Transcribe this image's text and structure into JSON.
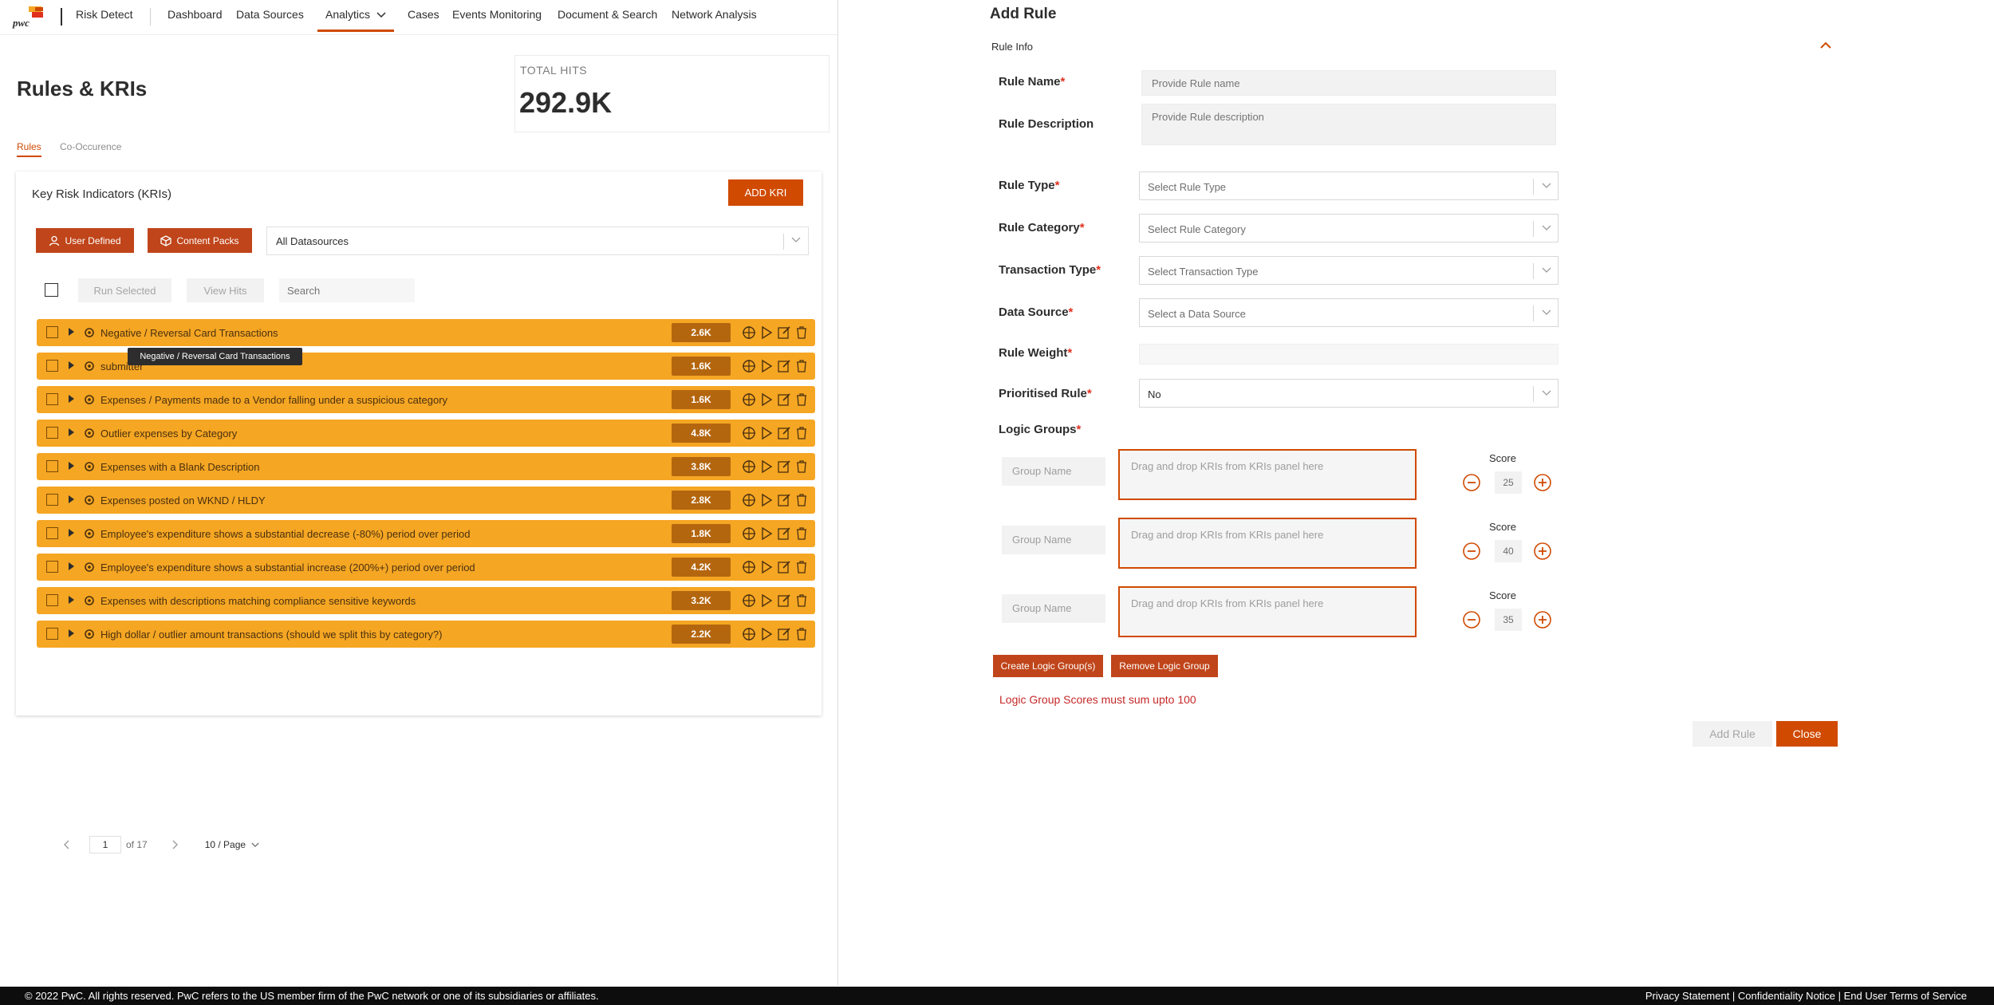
{
  "brand": {
    "logo_text": "pwc",
    "app_name": "Risk Detect",
    "accent_color": "#d04a02",
    "row_color": "#f5a623"
  },
  "nav": {
    "items": [
      {
        "label": "Dashboard"
      },
      {
        "label": "Data Sources"
      },
      {
        "label": "Analytics"
      },
      {
        "label": "Cases"
      },
      {
        "label": "Events Monitoring"
      },
      {
        "label": "Document & Search"
      },
      {
        "label": "Network Analysis"
      }
    ],
    "active": "Analytics"
  },
  "page": {
    "title": "Rules & KRIs",
    "total_hits_label": "TOTAL HITS",
    "total_hits_value": "292.9K",
    "tabs": [
      {
        "label": "Rules"
      },
      {
        "label": "Co-Occurence"
      }
    ],
    "active_tab": "Rules"
  },
  "kri_panel": {
    "title": "Key Risk Indicators (KRIs)",
    "add_kri_label": "ADD KRI",
    "filters": {
      "user_defined": "User Defined",
      "content_packs": "Content Packs"
    },
    "datasource_select": "All Datasources",
    "run_selected_label": "Run Selected",
    "view_hits_label": "View Hits",
    "search_placeholder": "Search",
    "rows": [
      {
        "name": "Negative / Reversal Card Transactions",
        "hits": "2.6K"
      },
      {
        "name": "submitter",
        "hits": "1.6K"
      },
      {
        "name": "Expenses / Payments made to a Vendor falling under a suspicious category",
        "hits": "1.6K"
      },
      {
        "name": "Outlier expenses by Category",
        "hits": "4.8K"
      },
      {
        "name": "Expenses with a Blank Description",
        "hits": "3.8K"
      },
      {
        "name": "Expenses posted on WKND / HLDY",
        "hits": "2.8K"
      },
      {
        "name": "Employee's expenditure shows a substantial decrease (-80%) period over period",
        "hits": "1.8K"
      },
      {
        "name": "Employee's expenditure shows a substantial increase (200%+) period over period",
        "hits": "4.2K"
      },
      {
        "name": "Expenses with descriptions matching compliance sensitive keywords",
        "hits": "3.2K"
      },
      {
        "name": "High dollar / outlier amount transactions (should we split this by category?)",
        "hits": "2.2K"
      }
    ],
    "tooltip": "Negative / Reversal Card Transactions",
    "pagination": {
      "current_page": "1",
      "of_text": "of 17",
      "page_size": "10 / Page"
    }
  },
  "add_rule": {
    "title": "Add Rule",
    "section": "Rule Info",
    "fields": {
      "rule_name_label": "Rule Name",
      "rule_name_placeholder": "Provide Rule name",
      "rule_description_label": "Rule Description",
      "rule_description_placeholder": "Provide Rule description",
      "rule_type_label": "Rule Type",
      "rule_type_value": "Select Rule Type",
      "rule_category_label": "Rule Category",
      "rule_category_value": "Select Rule Category",
      "transaction_type_label": "Transaction Type",
      "transaction_type_value": "Select Transaction Type",
      "data_source_label": "Data Source",
      "data_source_value": "Select a Data Source",
      "rule_weight_label": "Rule Weight",
      "prioritised_label": "Prioritised Rule",
      "prioritised_value": "No",
      "logic_groups_label": "Logic Groups",
      "required_mark": "*"
    },
    "logic_groups": [
      {
        "group_name": "Group Name",
        "drop_text": "Drag and drop KRIs from KRIs panel here",
        "score_label": "Score",
        "score": "25"
      },
      {
        "group_name": "Group Name",
        "drop_text": "Drag and drop KRIs from KRIs panel here",
        "score_label": "Score",
        "score": "40"
      },
      {
        "group_name": "Group Name",
        "drop_text": "Drag and drop KRIs from KRIs panel here",
        "score_label": "Score",
        "score": "35"
      }
    ],
    "create_groups_label": "Create Logic Group(s)",
    "remove_group_label": "Remove Logic Group",
    "warning": "Logic Group Scores must sum upto 100",
    "add_rule_label": "Add Rule",
    "close_label": "Close"
  },
  "footer": {
    "copyright": "© 2022 PwC. All rights reserved. PwC refers to the US member firm of the PwC network or one of its subsidiaries or affiliates.",
    "links": "Privacy Statement | Confidentiality Notice | End User Terms of Service"
  }
}
